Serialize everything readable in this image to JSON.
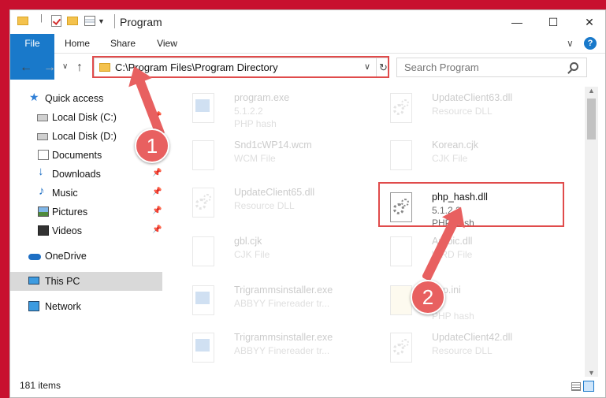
{
  "window": {
    "title": "Program",
    "controls": [
      "—",
      "☐",
      "✕"
    ]
  },
  "ribbon": {
    "tabs": [
      "File",
      "Home",
      "Share",
      "View"
    ],
    "collapse": "∨",
    "help": "?"
  },
  "nav": {
    "back": "←",
    "forward": "→",
    "recent": "∨",
    "up": "↑"
  },
  "address": {
    "path": "C:\\Program Files\\Program Directory",
    "dropdown": "∨",
    "refresh": "↻"
  },
  "search": {
    "placeholder": "Search Program"
  },
  "sidebar": {
    "items": [
      {
        "label": "Quick access",
        "icon": "star-icon",
        "pinned": false
      },
      {
        "label": "Local Disk (C:)",
        "icon": "drive-icon",
        "pinned": true
      },
      {
        "label": "Local Disk (D:)",
        "icon": "drive-icon",
        "pinned": false
      },
      {
        "label": "Documents",
        "icon": "documents-icon",
        "pinned": true
      },
      {
        "label": "Downloads",
        "icon": "download-icon",
        "pinned": true
      },
      {
        "label": "Music",
        "icon": "music-icon",
        "pinned": true
      },
      {
        "label": "Pictures",
        "icon": "pictures-icon",
        "pinned": true
      },
      {
        "label": "Videos",
        "icon": "videos-icon",
        "pinned": true
      },
      {
        "label": "OneDrive",
        "icon": "onedrive-icon",
        "pinned": false
      },
      {
        "label": "This PC",
        "icon": "this-pc-icon",
        "pinned": false,
        "selected": true
      },
      {
        "label": "Network",
        "icon": "network-icon",
        "pinned": false
      }
    ]
  },
  "files": [
    {
      "name": "program.exe",
      "line2": "5.1.2.2",
      "line3": "PHP hash",
      "icon": "exe-icon",
      "highlight": false
    },
    {
      "name": "UpdateClient63.dll",
      "line2": "Resource DLL",
      "line3": "",
      "icon": "dll-icon",
      "highlight": false
    },
    {
      "name": "Snd1cWP14.wcm",
      "line2": "WCM File",
      "line3": "",
      "icon": "file-icon",
      "highlight": false
    },
    {
      "name": "Korean.cjk",
      "line2": "CJK File",
      "line3": "",
      "icon": "file-icon",
      "highlight": false
    },
    {
      "name": "UpdateClient65.dll",
      "line2": "Resource DLL",
      "line3": "",
      "icon": "dll-icon",
      "highlight": false
    },
    {
      "name": "php_hash.dll",
      "line2": "5.1.2.2",
      "line3": "PHP hash",
      "icon": "dll-icon",
      "highlight": true
    },
    {
      "name": "gbl.cjk",
      "line2": "CJK File",
      "line3": "",
      "icon": "file-icon",
      "highlight": false
    },
    {
      "name": "Arabic.dll",
      "line2": "WRD File",
      "line3": "",
      "icon": "file-icon",
      "highlight": false
    },
    {
      "name": "Trigrammsinstaller.exe",
      "line2": "ABBYY Finereader tr...",
      "line3": "",
      "icon": "exe-icon",
      "highlight": false
    },
    {
      "name": "php.ini",
      "line2": "",
      "line3": "PHP hash",
      "icon": "file-icon",
      "highlight": false
    },
    {
      "name": "Trigrammsinstaller.exe",
      "line2": "ABBYY Finereader tr...",
      "line3": "",
      "icon": "exe-icon",
      "highlight": false
    },
    {
      "name": "UpdateClient42.dll",
      "line2": "Resource DLL",
      "line3": "",
      "icon": "dll-icon",
      "highlight": false
    }
  ],
  "status": {
    "count": "181 items"
  },
  "callouts": {
    "one": "1",
    "two": "2"
  },
  "colors": {
    "accent": "#1979ca",
    "callout": "#e86060",
    "highlight_border": "#e04b4b"
  }
}
